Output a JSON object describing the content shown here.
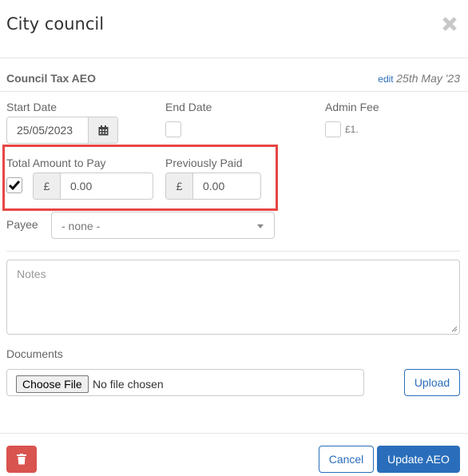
{
  "modal": {
    "title": "City council",
    "close_icon": "close-icon"
  },
  "record": {
    "name": "Council Tax AEO",
    "edit_label": "edit",
    "date": "25th May '23"
  },
  "fields": {
    "start_date": {
      "label": "Start Date",
      "value": "25/05/2023",
      "icon": "calendar-icon"
    },
    "end_date": {
      "label": "End Date",
      "checked": false
    },
    "admin_fee": {
      "label": "Admin Fee",
      "checked": false,
      "value_text": "£1."
    },
    "total_amount": {
      "label": "Total Amount to Pay",
      "checked": true,
      "currency": "£",
      "value": "0.00"
    },
    "previously_paid": {
      "label": "Previously Paid",
      "currency": "£",
      "value": "0.00"
    },
    "payee": {
      "label": "Payee",
      "selected": "- none -"
    },
    "notes": {
      "placeholder": "Notes",
      "value": ""
    },
    "documents": {
      "label": "Documents",
      "choose_label": "Choose File",
      "status": "No file chosen",
      "upload_label": "Upload"
    }
  },
  "footer": {
    "delete_icon": "trash-icon",
    "cancel_label": "Cancel",
    "submit_label": "Update AEO"
  },
  "colors": {
    "primary": "#2a6ebb",
    "danger": "#d9534f",
    "highlight": "#e84545"
  }
}
